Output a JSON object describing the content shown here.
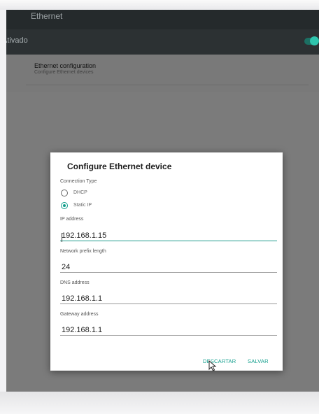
{
  "header": {
    "title": "Ethernet"
  },
  "master_switch": {
    "label": "Ativado",
    "on": true
  },
  "list_item": {
    "title": "Ethernet configuration",
    "subtitle": "Configure Ethernet devices"
  },
  "dialog": {
    "title": "Configure Ethernet device",
    "connection_type": {
      "label": "Connection Type",
      "options": [
        "DHCP",
        "Static IP"
      ],
      "selected": "Static IP"
    },
    "fields": {
      "ip": {
        "label": "IP address",
        "value": "192.168.1.15"
      },
      "prefix": {
        "label": "Network prefix length",
        "value": "24"
      },
      "dns": {
        "label": "DNS address",
        "value": "192.168.1.1"
      },
      "gateway": {
        "label": "Gateway address",
        "value": "192.168.1.1"
      }
    },
    "buttons": {
      "cancel": "DESCARTAR",
      "save": "SALVAR"
    }
  },
  "colors": {
    "accent": "#0f9d8b",
    "toolbar": "#252a2c",
    "scrim": "#7b7b7b"
  },
  "icons": [
    "mouse-pointer-icon"
  ]
}
